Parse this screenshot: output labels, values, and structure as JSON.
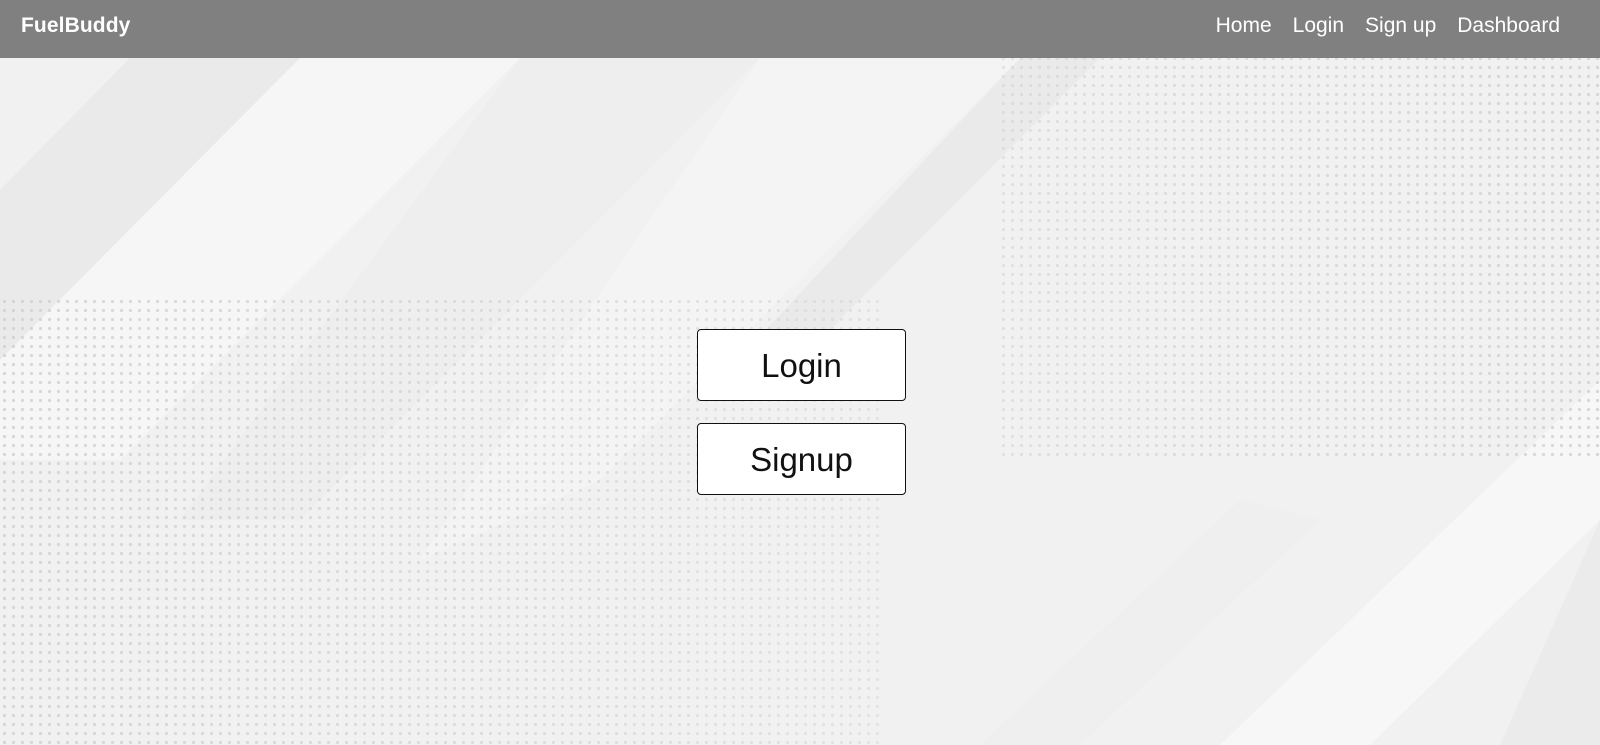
{
  "navbar": {
    "brand": "FuelBuddy",
    "links": [
      {
        "label": "Home"
      },
      {
        "label": "Login"
      },
      {
        "label": "Sign up"
      },
      {
        "label": "Dashboard"
      }
    ]
  },
  "main": {
    "login_label": "Login",
    "signup_label": "Signup"
  },
  "colors": {
    "navbar_bg": "#808080",
    "page_bg": "#f0f0f0",
    "button_bg": "#ffffff",
    "button_border": "#111111"
  }
}
